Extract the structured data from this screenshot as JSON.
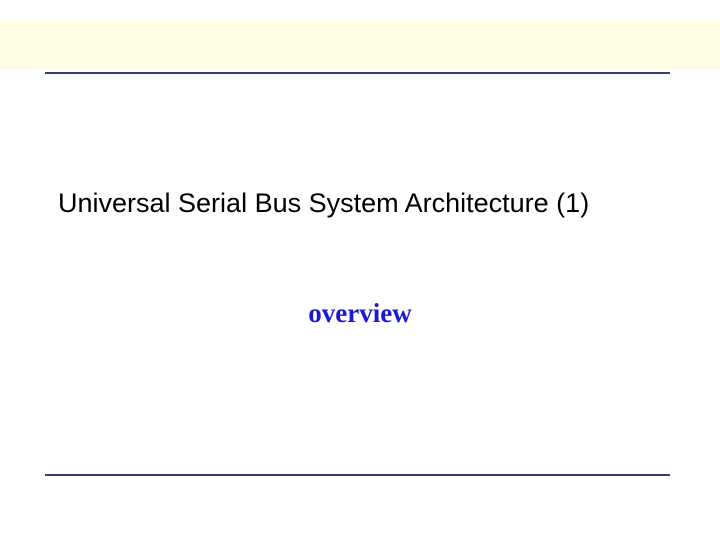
{
  "slide": {
    "title": "Universal Serial Bus System Architecture (1)",
    "subtitle": "overview"
  }
}
